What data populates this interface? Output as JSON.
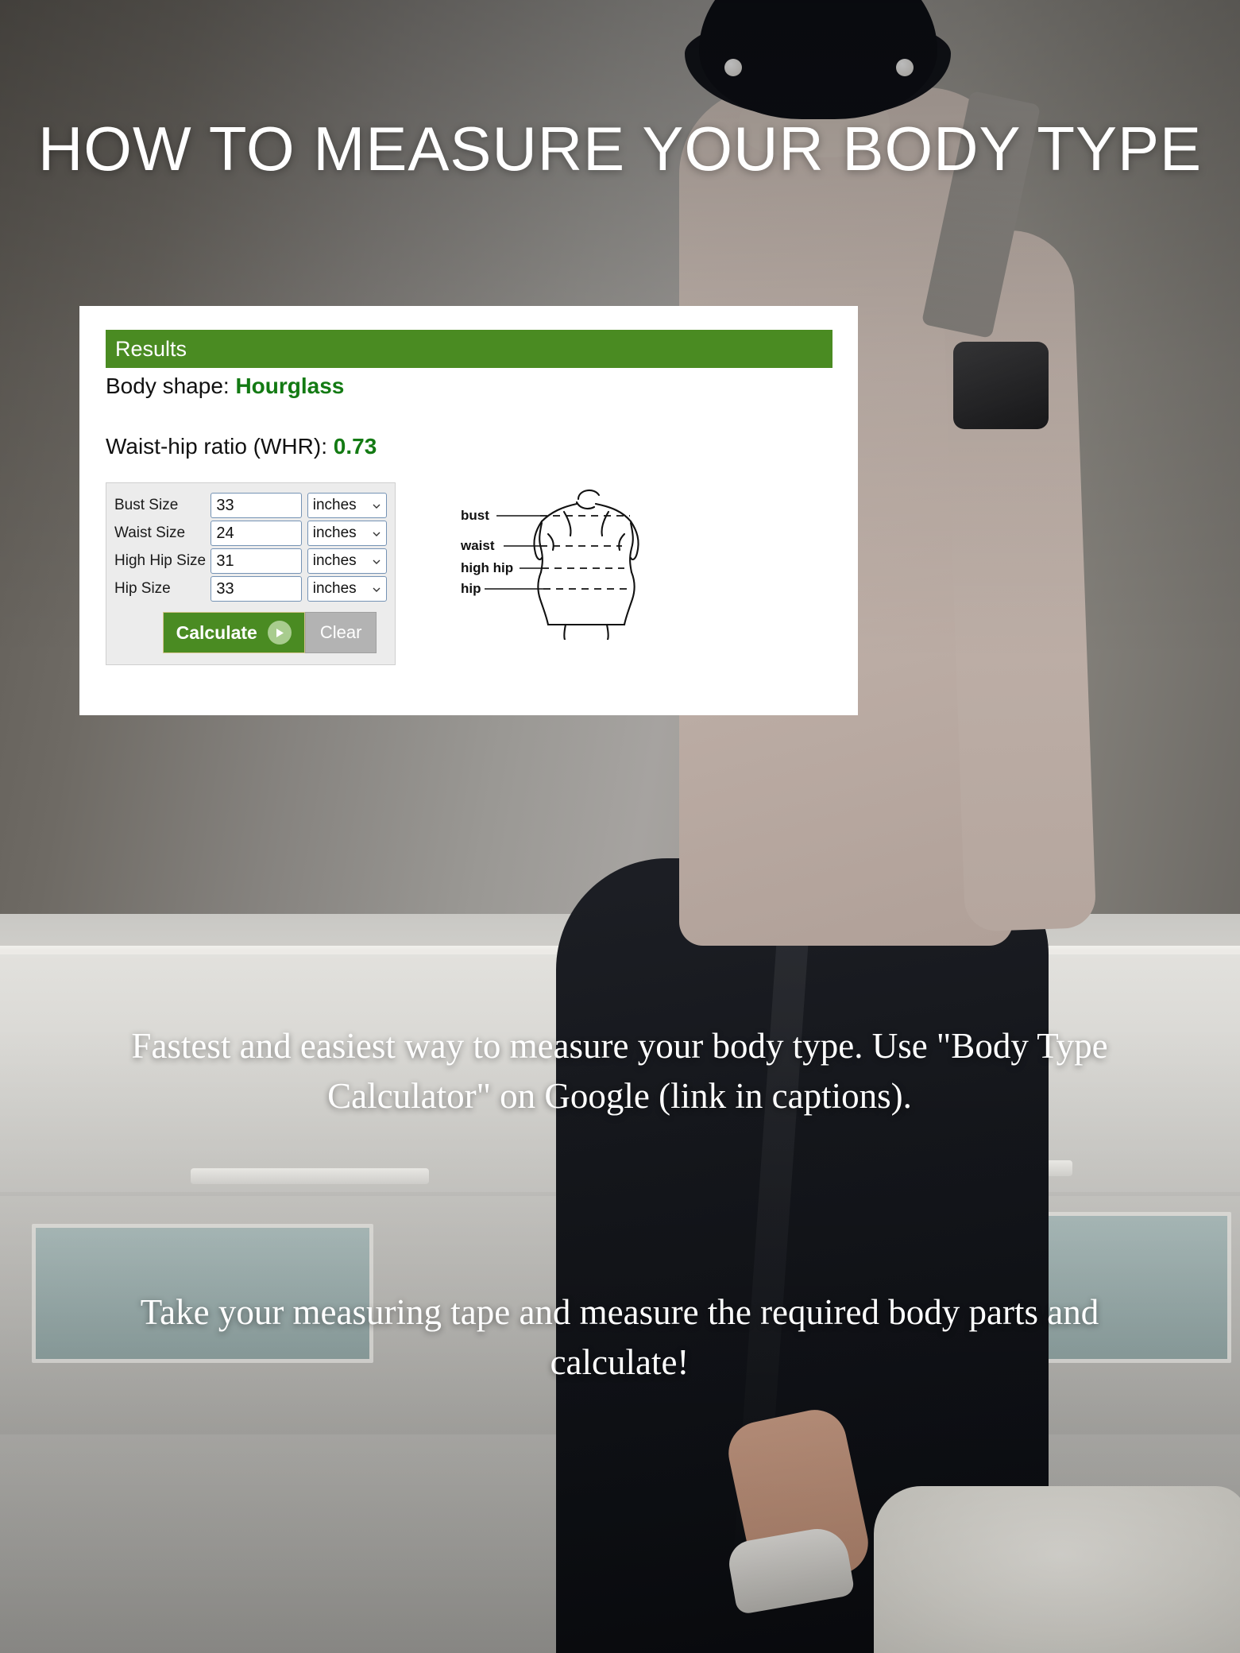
{
  "headline": "HOW TO MEASURE YOUR BODY TYPE",
  "calculator": {
    "results_header": "Results",
    "body_shape_label": "Body shape:",
    "body_shape_value": "Hourglass",
    "whr_label": "Waist-hip ratio (WHR):",
    "whr_value": "0.73",
    "rows": [
      {
        "label": "Bust Size",
        "value": "33",
        "unit": "inches"
      },
      {
        "label": "Waist Size",
        "value": "24",
        "unit": "inches"
      },
      {
        "label": "High Hip Size",
        "value": "31",
        "unit": "inches"
      },
      {
        "label": "Hip Size",
        "value": "33",
        "unit": "inches"
      }
    ],
    "calculate_label": "Calculate",
    "clear_label": "Clear",
    "diagram": {
      "labels": [
        "bust",
        "waist",
        "high hip",
        "hip"
      ]
    },
    "colors": {
      "header_green": "#4a8b22",
      "value_green": "#137a13",
      "form_background": "#ececec",
      "clear_grey": "#b3b3b3",
      "input_border": "#7593b5"
    },
    "icons": {
      "unit_dropdown": "chevron-down-icon",
      "calculate": "play-icon"
    }
  },
  "captions": {
    "first": "Fastest and easiest way to measure your body type. Use \"Body Type Calculator\" on Google (link in captions).",
    "second": "Take your measuring tape and measure the required body parts and calculate!"
  }
}
